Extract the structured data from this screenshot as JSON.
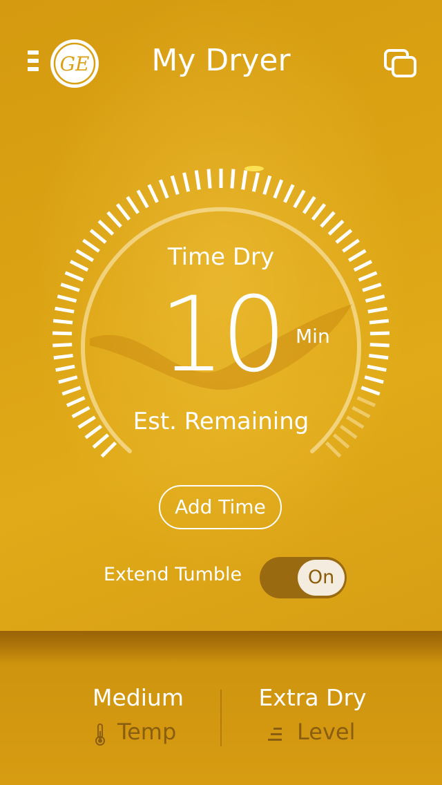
{
  "header": {
    "title": "My Dryer",
    "logo_text": "GE"
  },
  "dial": {
    "mode": "Time Dry",
    "remaining_value": "10",
    "remaining_unit": "Min",
    "remaining_label": "Est. Remaining"
  },
  "actions": {
    "add_time_label": "Add Time"
  },
  "extend_tumble": {
    "label": "Extend Tumble",
    "state": "On"
  },
  "settings": {
    "temp": {
      "value": "Medium",
      "name": "Temp",
      "icon": "thermometer-icon"
    },
    "level": {
      "value": "Extra Dry",
      "name": "Level",
      "icon": "level-icon"
    }
  },
  "colors": {
    "background": "#dca414",
    "toggle_track": "#9a6a10",
    "setting_name": "#8a5e10"
  }
}
